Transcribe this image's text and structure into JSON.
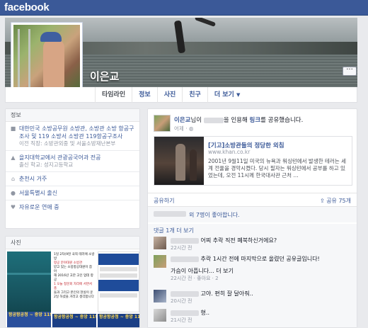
{
  "app": {
    "logo": "facebook"
  },
  "profile": {
    "name": "이은교",
    "cover_more": "···"
  },
  "nav": {
    "tabs": [
      {
        "label": "타임라인"
      },
      {
        "label": "정보"
      },
      {
        "label": "사진"
      },
      {
        "label": "친구"
      },
      {
        "label": "더 보기",
        "caret": "▼"
      }
    ]
  },
  "info": {
    "header": "정보",
    "items": [
      {
        "icon": "briefcase-icon",
        "main": "대한민국 소방공무원 소방관, 소방관 소방 항공구조사 및 119 소방서 소방관 119항공구조사",
        "sub": "이전 직장: 소방관외중 및 서울소방재난본부"
      },
      {
        "icon": "graduation-icon",
        "main": "을지대학교에서 관광공국어과 전공",
        "sub": "출신 학교: 성지고등학교"
      },
      {
        "icon": "home-icon",
        "main": "춘천시 거주",
        "sub": ""
      },
      {
        "icon": "pin-icon",
        "main": "서울특별시 출신",
        "sub": ""
      },
      {
        "icon": "heart-icon",
        "main": "자유로운 연애 중",
        "sub": ""
      }
    ]
  },
  "photos": {
    "header": "사진",
    "text_lines": [
      "1일 2차(9현 국적 테러에 소방방",
      "항공 분야대원 소방관",
      "받고 있는 소방항공대원이 참아",
      "해 2016년 고한 고인 업데 항공",
      "",
      "1 오늘 청문회 자리에 서면서 총",
      "들과 그리고 본인의 현실이 운",
      "2일 하셨을 거라고 생각합니다"
    ],
    "banner": "항공항공청 ~ 중앙 119구조본부"
  },
  "post": {
    "author": "이은교",
    "header_mid": "님이",
    "header_mid2": "을 인용해",
    "header_link": "링크",
    "header_end": "를 공유했습니다.",
    "time": "어제",
    "link": {
      "title": "[기고]소방관들의 정당한 외침",
      "domain": "www.khan.co.kr",
      "desc": "2001년 9월11일 미국의 뉴욕과 워싱턴에서 발생한 테러는 세계 전율을 경악시켰다. 당시 필자는 워싱턴에서 공부를 하고 있었는데, 오전 11시께 한국대사관 근처 ..."
    },
    "share_label": "공유하기",
    "share_count": "공유 75개",
    "likes_text": "외 7명이 좋아합니다.",
    "more_comments": "댓글 1개 더 보기",
    "comments": [
      {
        "text": "어찌 추락 직전 폐북하신거에요?",
        "meta": "22시간 전"
      },
      {
        "text": "추락 1시간 전에 마지막으로 올렸던 공유글입니다!",
        "meta": ""
      },
      {
        "text": "가슴이 아픕니다... 더 보기",
        "meta": "22시간 전 · 좋아요 · 2"
      },
      {
        "text": "고야. 편히 잘 달아줘..",
        "meta": "20시간 전"
      },
      {
        "text": "형..",
        "meta": "21시간 전"
      }
    ]
  },
  "colors": {
    "brand": "#3b5998",
    "link": "#3b5998",
    "muted": "#9197a3"
  }
}
